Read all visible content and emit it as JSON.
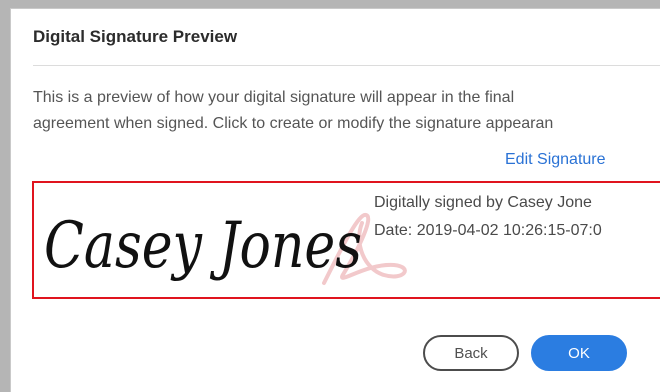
{
  "dialog": {
    "title": "Digital Signature Preview",
    "description_line1": "This is a preview of how your digital signature will appear in the final",
    "description_line2": "agreement when signed. Click to create or modify the signature appearan",
    "edit_link": "Edit Signature"
  },
  "signature": {
    "handwritten_name": "Casey Jones",
    "signed_by": "Digitally signed by Casey Jone",
    "date": "Date: 2019-04-02 10:26:15-07:0",
    "highlight_color": "#e0141e"
  },
  "buttons": {
    "back_label": "Back",
    "ok_label": "OK",
    "ok_color": "#2b7de1"
  }
}
